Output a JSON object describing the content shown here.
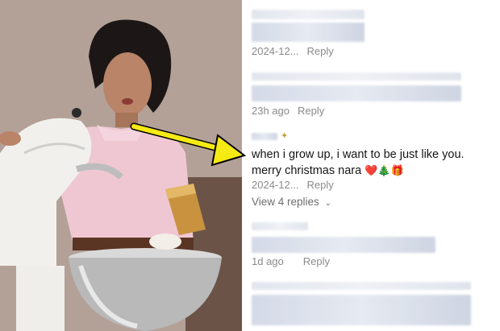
{
  "comments": [
    {
      "meta_time": "2024-12...",
      "reply_label": "Reply"
    },
    {
      "meta_time": "23h ago",
      "reply_label": "Reply"
    },
    {
      "text": "when i grow up, i want to be just like you. merry christmas nara",
      "emojis": "❤️🎄🎁",
      "meta_time": "2024-12...",
      "reply_label": "Reply",
      "view_replies": "View 4 replies"
    },
    {
      "meta_time": "1d ago",
      "reply_label": "Reply"
    }
  ],
  "colors": {
    "arrow": "#f6ea14",
    "text": "#161616",
    "meta": "#8a8a8a"
  }
}
